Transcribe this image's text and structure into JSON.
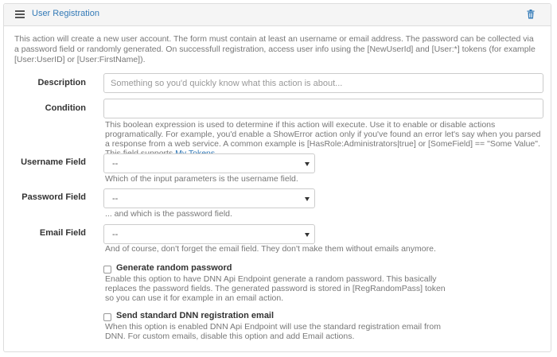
{
  "header": {
    "title": "User Registration",
    "menu_icon": "hamburger-icon",
    "delete_icon": "trash-icon",
    "accent": "#337ab7"
  },
  "intro": "This action will create a new user account. The form must contain at least an username or email address. The password can be collected via a password field or randomly generated. On successfull registration, access user info using the [NewUserId] and [User:*] tokens (for example [User:UserID] or [User:FirstName]).",
  "description": {
    "label": "Description",
    "value": "",
    "placeholder": "Something so you'd quickly know what this action is about..."
  },
  "condition": {
    "label": "Condition",
    "value": "",
    "help": "This boolean expression is used to determine if this action will execute. Use it to enable or disable actions programatically. For example, you'd enable a ShowError action only if you've found an error let's say when you parsed a response from a web service. A common example is [HasRole:Administrators|true] or [SomeField] == \"Some Value\". This field supports",
    "help_link": "My Tokens",
    "help_end": "."
  },
  "username_field": {
    "label": "Username Field",
    "selected": "--",
    "help": "Which of the input parameters is the username field."
  },
  "password_field": {
    "label": "Password Field",
    "selected": "--",
    "help": "... and which is the password field."
  },
  "email_field": {
    "label": "Email Field",
    "selected": "--",
    "help": "And of course, don't forget the email field. They don't make them without emails anymore."
  },
  "generate_password": {
    "label": "Generate random password",
    "checked": false,
    "help": "Enable this option to have DNN Api Endpoint generate a random password. This basically replaces the password fields. The generated password is stored in [RegRandomPass] token so you can use it for example in an email action."
  },
  "send_email": {
    "label": "Send standard DNN registration email",
    "checked": false,
    "help": "When this option is enabled DNN Api Endpoint will use the standard registration email from DNN. For custom emails, disable this option and add Email actions."
  }
}
